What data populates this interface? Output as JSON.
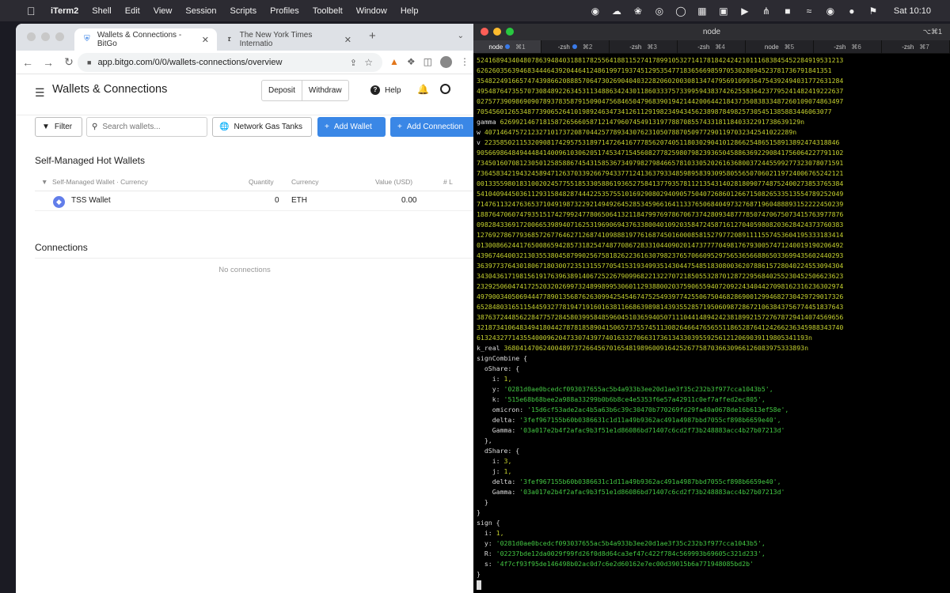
{
  "menubar": {
    "app_name": "iTerm2",
    "items": [
      "Shell",
      "Edit",
      "View",
      "Session",
      "Scripts",
      "Profiles",
      "Toolbelt",
      "Window",
      "Help"
    ],
    "clock": "Sat 10:10"
  },
  "browser": {
    "tabs": [
      {
        "title": "Wallets & Connections - BitGo"
      },
      {
        "title": "The New York Times Internatio"
      }
    ],
    "url": "app.bitgo.com/0/0/wallets-connections/overview"
  },
  "page": {
    "title": "Wallets & Connections",
    "deposit_label": "Deposit",
    "withdraw_label": "Withdraw",
    "help_label": "Help",
    "filter_label": "Filter",
    "search_placeholder": "Search wallets...",
    "gas_label": "Network Gas Tanks",
    "add_wallet_label": "Add Wallet",
    "add_connection_label": "Add Connection",
    "section_hot": "Self-Managed Hot Wallets",
    "table_headers": {
      "wallet": "Self-Managed Wallet · Currency",
      "quantity": "Quantity",
      "currency": "Currency",
      "value": "Value (USD)",
      "num": "# L"
    },
    "wallet_row": {
      "name": "TSS Wallet",
      "quantity": "0",
      "currency": "ETH",
      "value": "0.00"
    },
    "section_connections": "Connections",
    "no_connections": "No connections"
  },
  "terminal": {
    "title": "node",
    "shortcut": "⌥⌘1",
    "tabs": [
      {
        "name": "node",
        "shortcut": "⌘1",
        "dot": true
      },
      {
        "name": "-zsh",
        "shortcut": "⌘2",
        "dot": true
      },
      {
        "name": "-zsh",
        "shortcut": "⌘3",
        "dot": false
      },
      {
        "name": "-zsh",
        "shortcut": "⌘4",
        "dot": false
      },
      {
        "name": "node",
        "shortcut": "⌘5",
        "dot": false
      },
      {
        "name": "-zsh",
        "shortcut": "⌘6",
        "dot": false
      },
      {
        "name": "-zsh",
        "shortcut": "⌘7",
        "dot": false
      }
    ],
    "digit_lines": [
      "5241689434048078639484031881782556418811527417899105327141781842424210111683845452284919531213",
      "6262603563946834446439204464124861997193745129535477183656698597053028094523781736791841351",
      "3548224916657474398662088857064730269040403228206020030813474795691099364754392494031772631284",
      "4954876473557073084892263453113488634243011860333757339959438374262558364237795241482419222637",
      "0275773909869090789378358791509047568465047968390194214420064421843735083833487260109074863497",
      "7054560126534877390652641019892463473412611291982349434562389878498257305451385883446063077"
    ],
    "gamma_label": "gamma",
    "gamma_value": "62699214671815872656605871214796074549131977887085574331811840332291738639129n",
    "w_label": "w",
    "w_value": "4071464757212327101737208704425778934307623105078870509772901197032342541022289n",
    "v_label": "v",
    "v_lines": [
      "2235850211532090817429575318971472641677785620740511803029041012866254865158913892474318846",
      "9056698648494448414009610306205174534715456082778259807982393650458863692290841756064227791102",
      "7345016070812305012585886745431585367349798279846657810330520261636800372445599277323078071591",
      "7364583421943245894712637033926679433771241363793348598958393095805565070602119724006765242121",
      "0013355980183100202457755185330588619365275841377935781121354314028180907748752400273853765384",
      "5410409445036112931584828744422535755101692908029409057504072686012667150826533513554789252049",
      "7147611324763653710491987322921494926452853459661641133765068404973276871960488893152222450239",
      "1887647060747935151742799247780650641321184799769786706737428093487778507470675073415763977876",
      "0982843369172006653989407162531969069437633800401092035847245871612704059808203628424373760383",
      "1276927867793685726776462712687410988819776168745016000858152797720891111557453604195333183414",
      "0130086624417650086594285731825474877086728331044090201473777704981767930057471240019190206492",
      "4396746400321303553804587990256758182622361630798237657066095297565365668865033699435602440293",
      "3639773764301806718030072351315577054153193499351430447548518308003620788615728040224553094304",
      "3430436171981561917639638914067252267909968221322707218505532870128722956840255230452506623623",
      "2329250604741725203202699732489989953060112938800203759065594072092243404427098162316236302974",
      "4979003405069444778901356876263099425454674752549397742550675046828690012994682730429729017326",
      "6528480316511544593277819471916016381166863989814393552857195060987286721063843756774451837643",
      "3876372448562284775728458039958485960451036594050711104414894242381899215727678729414074569656",
      "3218734106483494180442787818589041506573755745113082646647656551186528764124266236345988343740",
      "6132432771435540009620473307439774016332706631736134330395592561212069039119805341193n"
    ],
    "kreal_label": "k_real",
    "kreal_value": "36804147062400489737266456701654819896009164252677587036630966126083975333893n",
    "signCombine_label": "signCombine {",
    "oShare_label": "oShare: {",
    "oShare": {
      "i_key": "i:",
      "i": "1,",
      "y_key": "y:",
      "y": "'0281d0ae0bcedcf093037655ac5b4a933b3ee20d1ae3f35c232b3f977cca1043b5',",
      "k_key": "k:",
      "k": "'515e68b68bee2a988a33299b0b6b8ce4e5353f6e57a42911c0ef7affed2ec805',",
      "omicron_key": "omicron:",
      "omicron": "'15d6cf53ade2ac4b5a63b6c39c30470b770269fd29fa40a0678de16b613ef58e',",
      "delta_key": "delta:",
      "delta": "'3fef967155b60b0386631c1d11a49b9362ac491a4987bbd7055cf898b6659e40',",
      "Gamma_key": "Gamma:",
      "Gamma": "'03a017e2b4f2afac9b3f51e1d86086bd71407c6cd2f73b248883acc4b27b07213d'"
    },
    "close_obj": "},",
    "dShare_label": "dShare: {",
    "dShare": {
      "i_key": "i:",
      "i": "3,",
      "j_key": "j:",
      "j": "1,",
      "delta_key": "delta:",
      "delta": "'3fef967155b60b0386631c1d11a49b9362ac491a4987bbd7055cf898b6659e40',",
      "Gamma_key": "Gamma:",
      "Gamma": "'03a017e2b4f2afac9b3f51e1d86086bd71407c6cd2f73b248883acc4b27b07213d'"
    },
    "close_brace": "}",
    "sign_label": "sign {",
    "sign": {
      "i_key": "i:",
      "i": "1,",
      "y_key": "y:",
      "y": "'0281d0ae0bcedcf093037655ac5b4a933b3ee20d1ae3f35c232b3f977cca1043b5',",
      "R_key": "R:",
      "R": "'02237bde12da0029f99fd26f0d8d64ca3ef47c422f784c569993b69605c321d233',",
      "s_key": "s:",
      "s": "'4f7cf93f95de146498b02ac0d7c6e2d60162e7ec00d39015b6a771948085bd2b'"
    }
  }
}
